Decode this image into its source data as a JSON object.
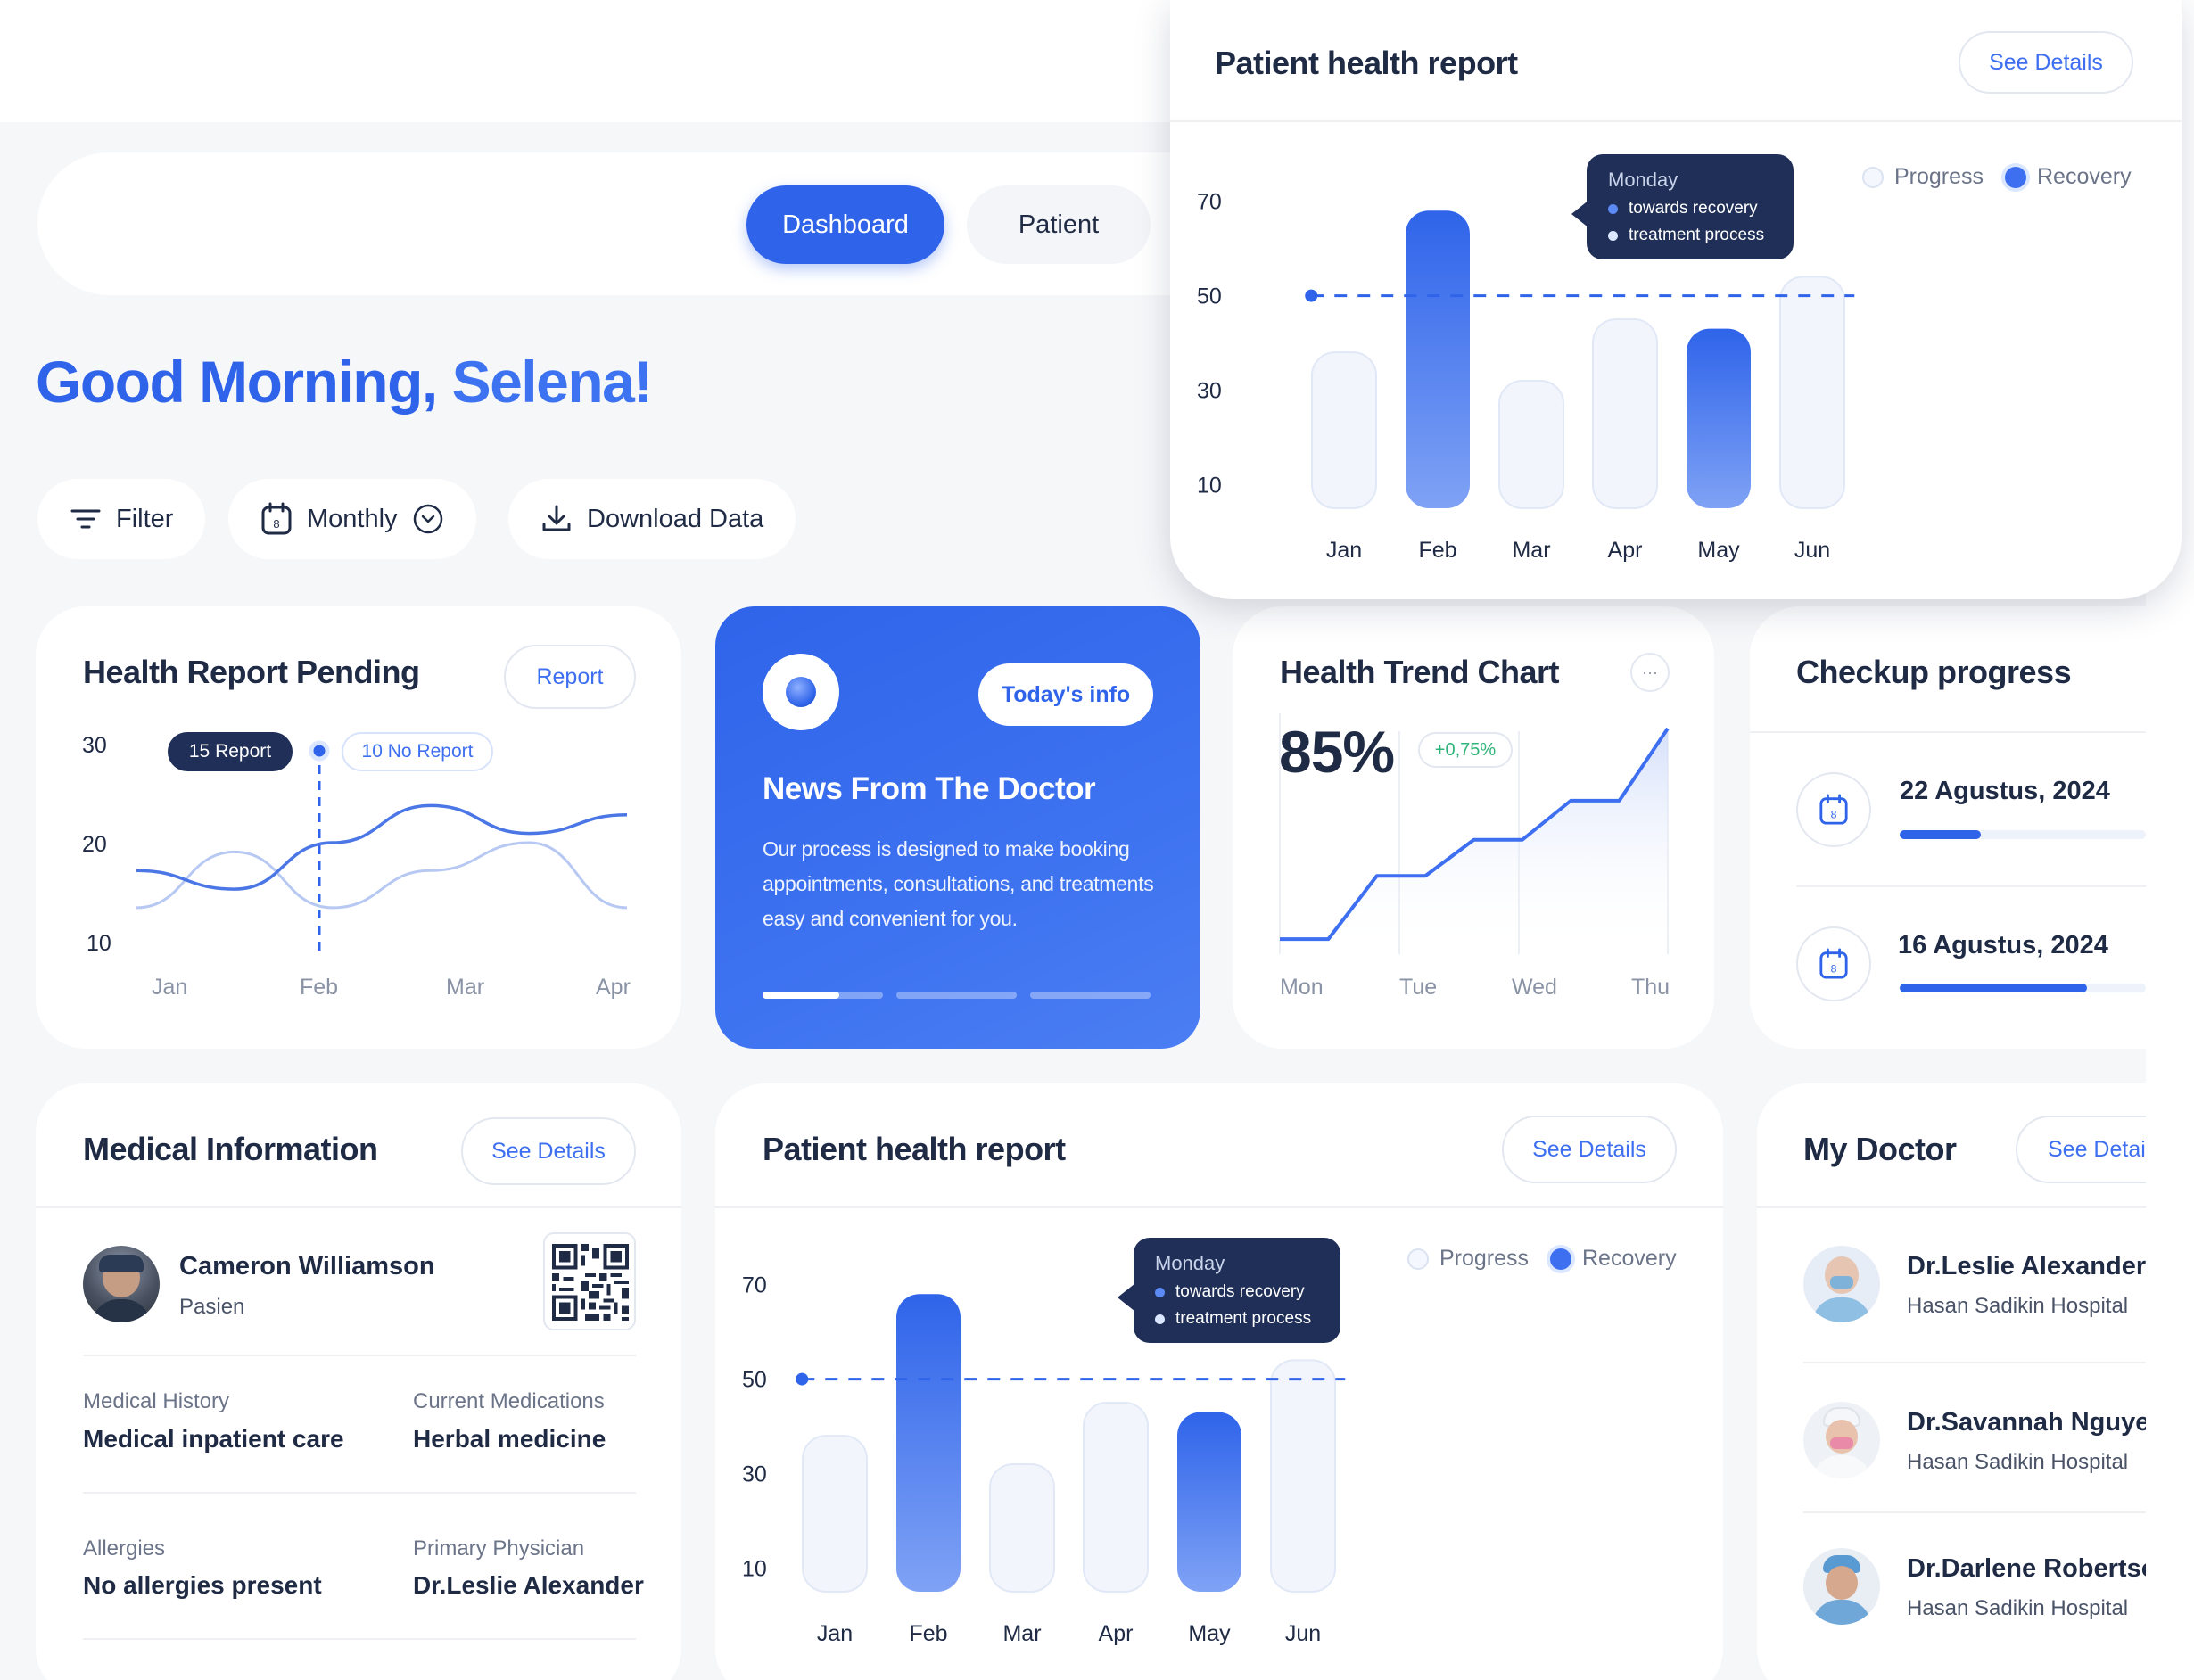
{
  "colors": {
    "primary": "#2f64ea",
    "dark": "#1f2a44",
    "light_bar": "#f0f4fd",
    "tooltip": "#1f2f57"
  },
  "nav": {
    "tabs": [
      {
        "label": "Dashboard",
        "active": true
      },
      {
        "label": "Patient",
        "active": false
      }
    ]
  },
  "greeting": {
    "prefix": "Good Morning,",
    "name": "Selena!"
  },
  "toolbar": {
    "filter": "Filter",
    "period": "Monthly",
    "period_day": "8",
    "download": "Download Data"
  },
  "floating_report": {
    "title": "Patient health report",
    "see_details": "See Details",
    "legend": [
      "Progress",
      "Recovery"
    ],
    "tooltip": {
      "title": "Monday",
      "rows": [
        "towards recovery",
        "treatment process"
      ]
    }
  },
  "health_pending": {
    "title": "Health Report Pending",
    "button": "Report",
    "badge_dark": "15 Report",
    "badge_light": "10 No Report"
  },
  "news": {
    "badge": "Today's info",
    "title": "News From The Doctor",
    "body": "Our process is designed to make booking appointments, consultations, and treatments easy and convenient for you.",
    "slide_index": 1,
    "slide_count": 3
  },
  "trend": {
    "title": "Health Trend Chart",
    "more": "···",
    "percent": "85%",
    "change": "+0,75%"
  },
  "checkup": {
    "title": "Checkup progress",
    "items": [
      {
        "date": "22 Agustus, 2024",
        "day": "8",
        "progress": 0.33
      },
      {
        "date": "16 Agustus, 2024",
        "day": "8",
        "progress": 0.76
      }
    ]
  },
  "medical": {
    "title": "Medical Information",
    "see_details": "See Details",
    "patient_name": "Cameron Williamson",
    "patient_role": "Pasien",
    "fields": [
      {
        "label": "Medical History",
        "value": "Medical inpatient care"
      },
      {
        "label": "Current Medications",
        "value": "Herbal medicine"
      },
      {
        "label": "Allergies",
        "value": "No allergies present"
      },
      {
        "label": "Primary Physician",
        "value": "Dr.Leslie Alexander"
      }
    ]
  },
  "report2": {
    "title": "Patient health report",
    "see_details": "See Details",
    "legend": [
      "Progress",
      "Recovery"
    ],
    "tooltip": {
      "title": "Monday",
      "rows": [
        "towards recovery",
        "treatment process"
      ]
    }
  },
  "doctors": {
    "title": "My Doctor",
    "see_details": "See Detail",
    "list": [
      {
        "name": "Dr.Leslie Alexander",
        "hospital": "Hasan Sadikin Hospital"
      },
      {
        "name": "Dr.Savannah Nguyen",
        "hospital": "Hasan Sadikin Hospital"
      },
      {
        "name": "Dr.Darlene Robertson",
        "hospital": "Hasan Sadikin Hospital"
      }
    ]
  },
  "chart_data": [
    {
      "id": "patient_health_report",
      "type": "bar",
      "title": "Patient health report",
      "categories": [
        "Jan",
        "Feb",
        "Mar",
        "Apr",
        "May",
        "Jun"
      ],
      "y_ticks": [
        10,
        30,
        50,
        70
      ],
      "ylim": [
        5,
        72
      ],
      "values": [
        38,
        68,
        32,
        45,
        43,
        54
      ],
      "highlighted": [
        "Feb",
        "May"
      ],
      "reference_line": 50,
      "legend": [
        "Progress",
        "Recovery"
      ]
    },
    {
      "id": "health_report_pending",
      "type": "line",
      "title": "Health Report Pending",
      "x": [
        "Jan",
        "Feb",
        "Mar",
        "Apr"
      ],
      "y_ticks": [
        10,
        20,
        30
      ],
      "ylim": [
        8,
        32
      ],
      "series": [
        {
          "name": "15 Report",
          "values": [
            17,
            15,
            20,
            24,
            21,
            23
          ]
        },
        {
          "name": "10 No Report",
          "values": [
            13,
            19,
            13,
            17,
            20,
            13
          ]
        }
      ]
    },
    {
      "id": "health_trend",
      "type": "area",
      "title": "Health Trend Chart",
      "x": [
        "Mon",
        "Tue",
        "Wed",
        "Thu"
      ],
      "values": [
        10,
        10,
        52,
        52,
        76,
        76,
        102,
        102,
        150
      ],
      "ylim": [
        0,
        160
      ]
    }
  ]
}
